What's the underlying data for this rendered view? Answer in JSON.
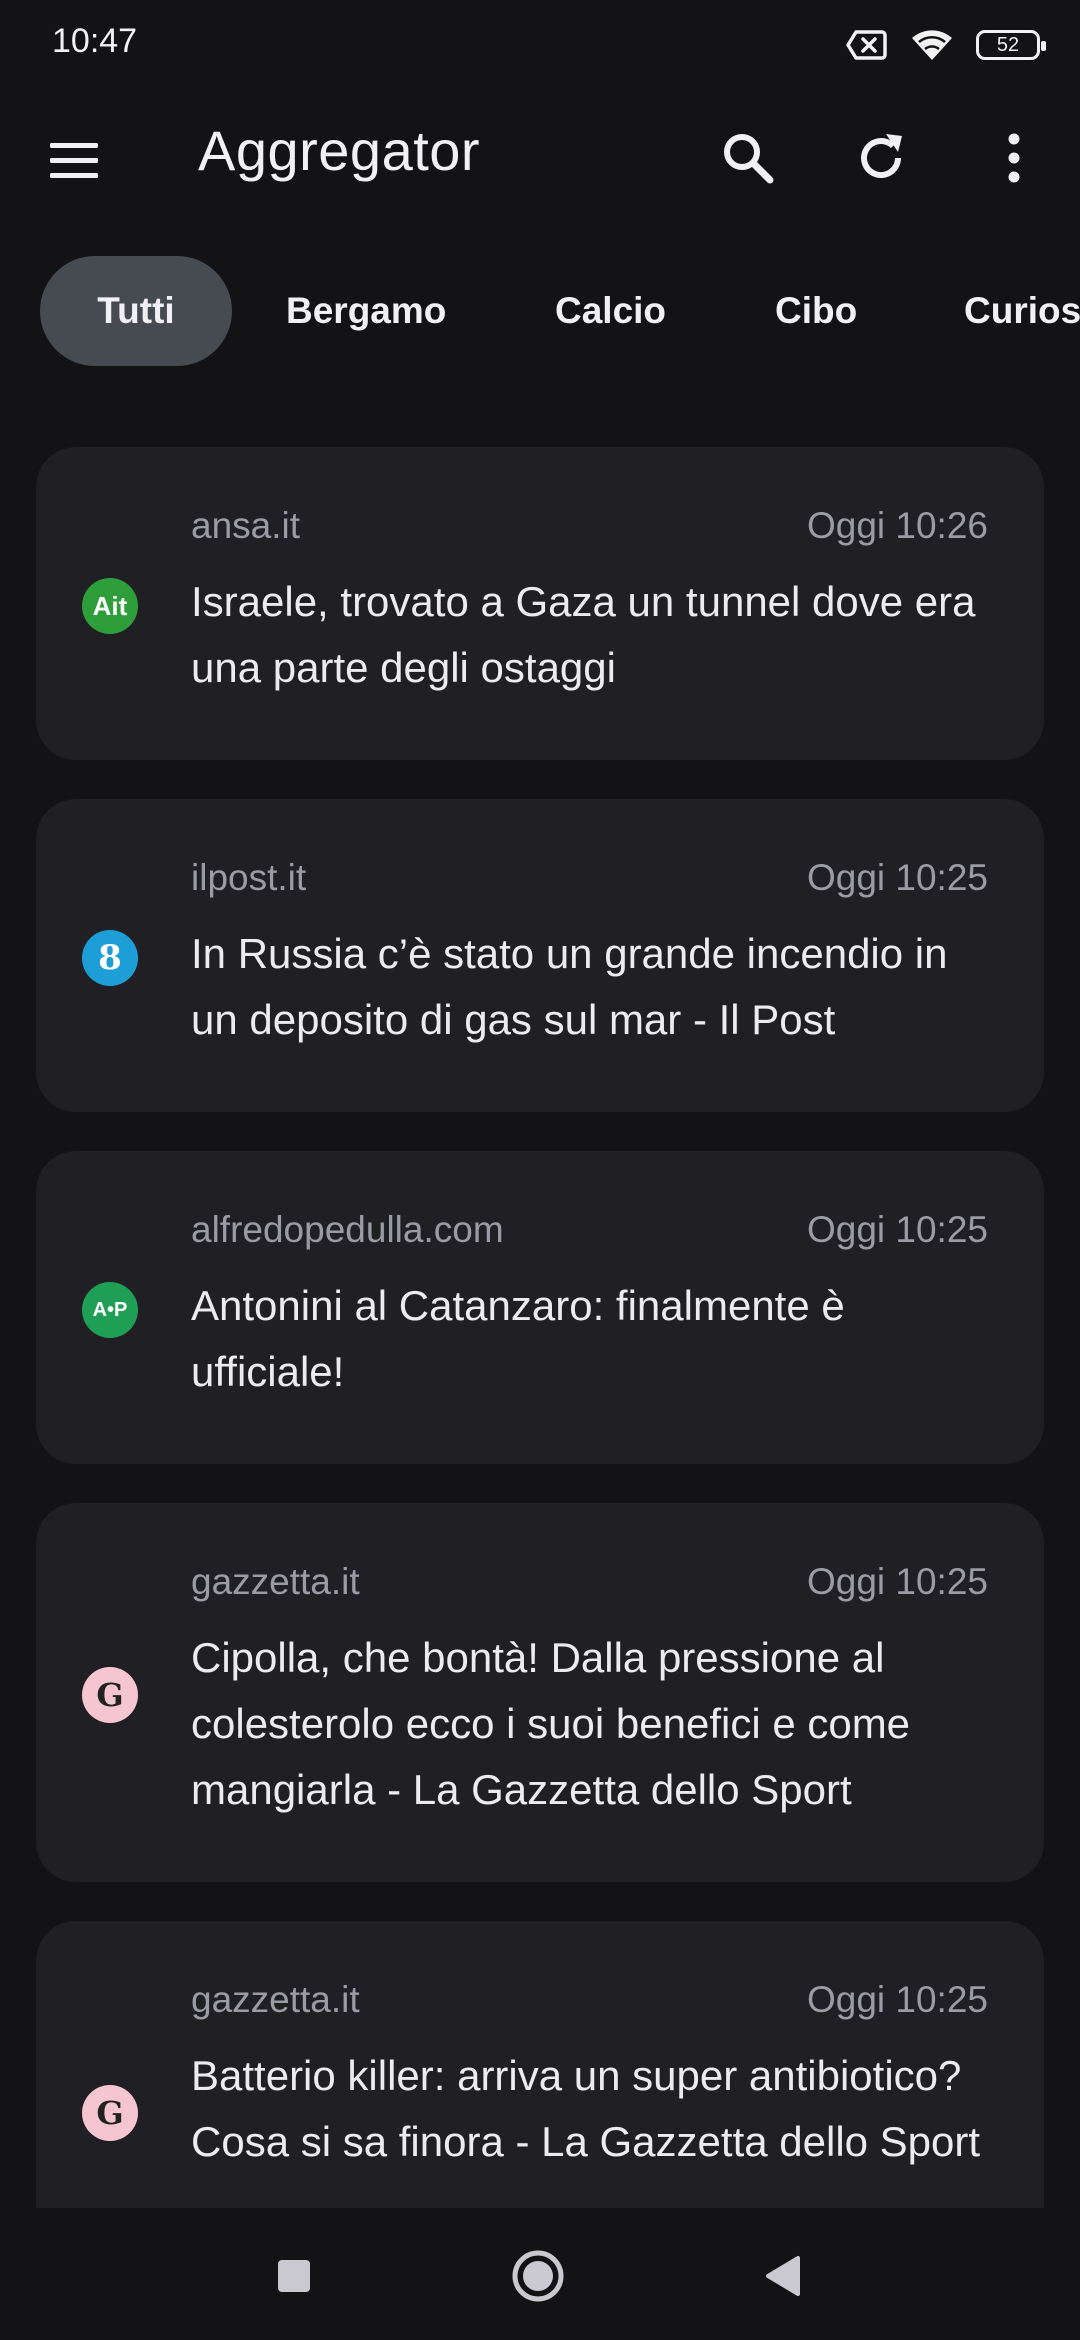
{
  "status_bar": {
    "time": "10:47",
    "battery": "52"
  },
  "app_bar": {
    "title": "Aggregator"
  },
  "chips": [
    {
      "label": "Tutti",
      "selected": true
    },
    {
      "label": "Bergamo"
    },
    {
      "label": "Calcio"
    },
    {
      "label": "Cibo"
    },
    {
      "label": "Curios"
    }
  ],
  "cards": [
    {
      "source": "ansa.it",
      "time": "Oggi 10:26",
      "title": "Israele, trovato a Gaza un tunnel dove era una parte degli ostaggi",
      "favicon": {
        "text": "Ait",
        "icon": "ansa-favicon-icon"
      }
    },
    {
      "source": "ilpost.it",
      "time": "Oggi 10:25",
      "title": "In Russia c’è stato un grande incendio in un deposito di gas sul mar - Il Post",
      "favicon": {
        "text": "8",
        "icon": "ilpost-favicon-icon"
      }
    },
    {
      "source": "alfredopedulla.com",
      "time": "Oggi 10:25",
      "title": "Antonini al Catanzaro: finalmente è ufficiale!",
      "favicon": {
        "text": "A•P",
        "icon": "alfredopedulla-favicon-icon"
      }
    },
    {
      "source": "gazzetta.it",
      "time": "Oggi 10:25",
      "title": "Cipolla, che bontà! Dalla pressione al colesterolo ecco i suoi benefici e come mangiarla - La Gazzetta dello Sport",
      "favicon": {
        "text": "G",
        "icon": "gazzetta-favicon-icon"
      }
    },
    {
      "source": "gazzetta.it",
      "time": "Oggi 10:25",
      "title": "Batterio killer: arriva un super antibiotico? Cosa si sa finora - La Gazzetta dello Sport",
      "favicon": {
        "text": "G",
        "icon": "gazzetta-favicon-icon"
      }
    }
  ],
  "colors": {
    "background": "#131316",
    "card": "#1f1f24",
    "chip_selected": "#464b52",
    "muted_text": "#9b9ba3"
  }
}
